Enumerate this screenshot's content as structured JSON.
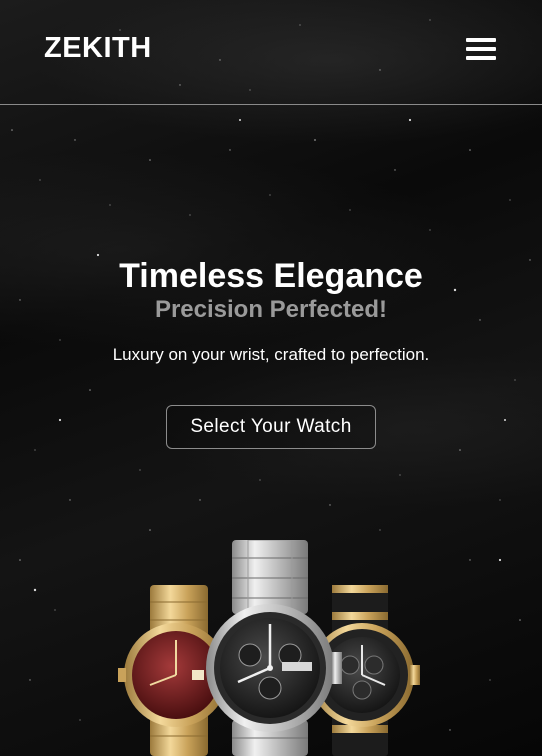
{
  "header": {
    "logo": "ZEKITH",
    "menu_icon": "hamburger-menu-icon"
  },
  "hero": {
    "title": "Timeless Elegance",
    "subtitle": "Precision Perfected!",
    "tagline": "Luxury on your wrist, crafted to perfection.",
    "cta_label": "Select Your Watch"
  },
  "colors": {
    "background": "#0a0a0a",
    "text": "#ffffff",
    "subtitle": "#9a9a9a",
    "divider": "#8a8a8a"
  }
}
